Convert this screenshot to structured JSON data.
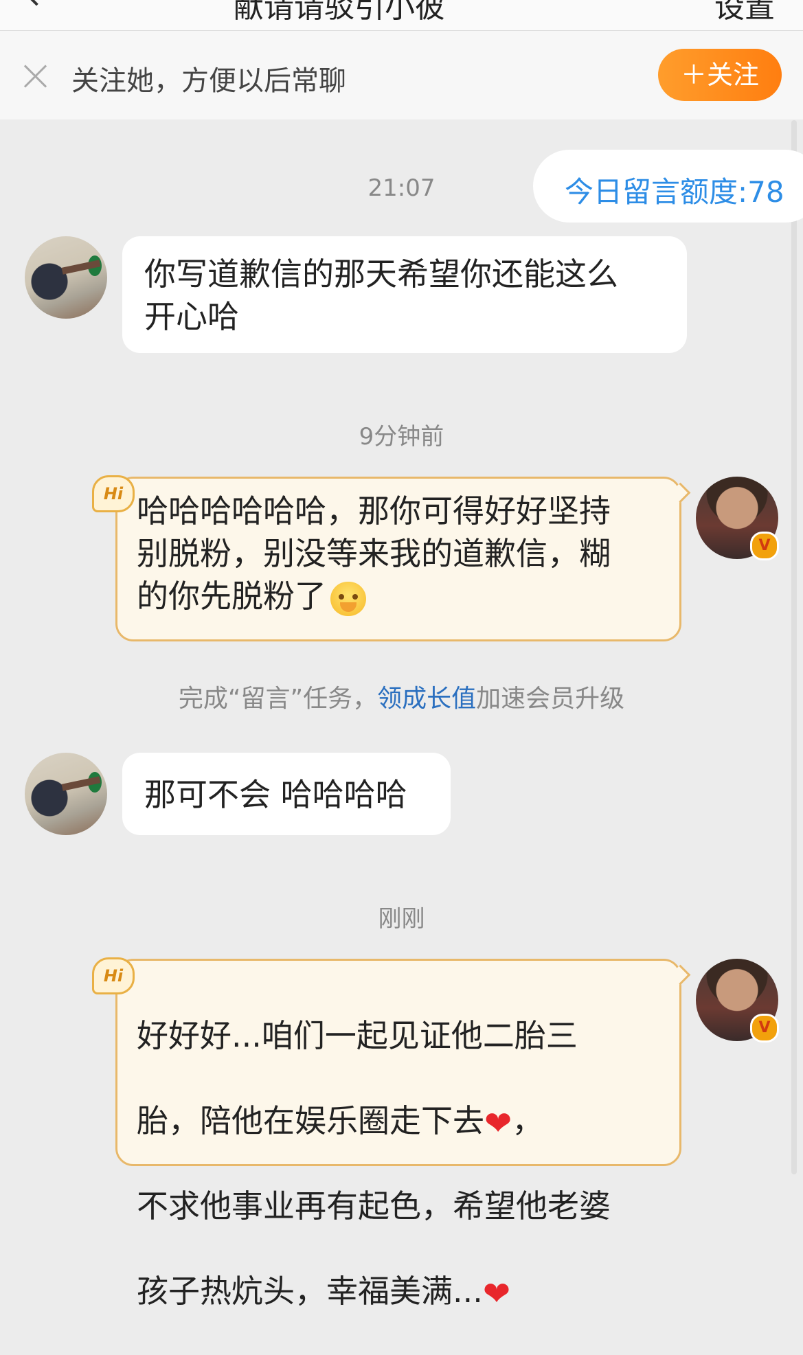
{
  "topbar": {
    "title": "献请请驳引小彼",
    "settings": "设置"
  },
  "follow_bar": {
    "hint": "关注她，方便以后常聊",
    "follow_button": "＋关注"
  },
  "quota": {
    "label": "今日留言额度:78"
  },
  "timestamps": {
    "t1": "21:07",
    "t2": "9分钟前",
    "t3": "刚刚"
  },
  "messages": [
    {
      "side": "left",
      "text": "你写道歉信的那天希望你还能这么\n开心哈"
    },
    {
      "side": "right",
      "text": "哈哈哈哈哈哈，那你可得好好坚持\n别脱粉，别没等来我的道歉信，糊\n的你先脱粉了",
      "emoji": "crying-face-emoji"
    },
    {
      "side": "left",
      "text": "那可不会  哈哈哈哈"
    },
    {
      "side": "right",
      "line1": "好好好...咱们一起见证他二胎三",
      "line2": "胎，陪他在娱乐圈走下去",
      "line2_end": "，",
      "line3": "不求他事业再有起色，希望他老婆",
      "line4": "孩子热炕头，幸福美满...",
      "heart": "❤"
    }
  ],
  "task": {
    "prefix": "完成“留言”任务，",
    "link": "领成长值",
    "suffix": "加速会员升级"
  },
  "badges": {
    "hi": "Hi",
    "verified": "V"
  },
  "colors": {
    "accent_orange": "#ff8a1a",
    "link_blue": "#2a6fbf",
    "quota_blue": "#2d8de6",
    "right_bubble_bg": "#fdf7ea",
    "right_bubble_border": "#e8b86a"
  }
}
